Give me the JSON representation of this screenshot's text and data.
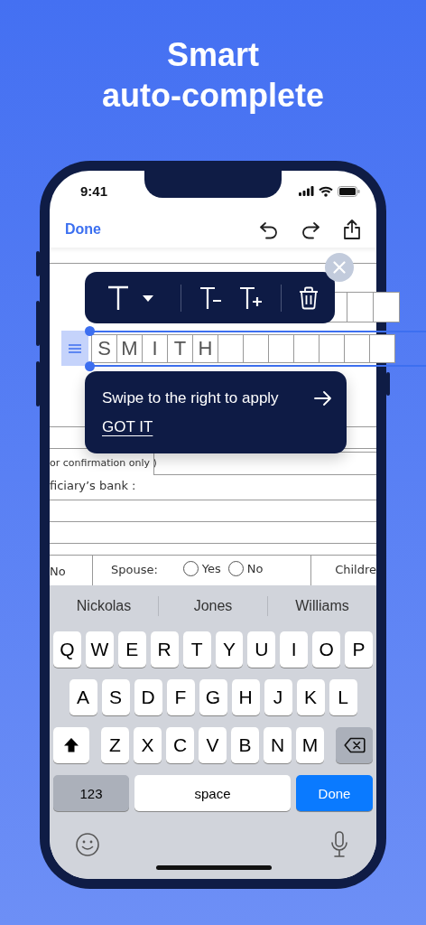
{
  "headline": [
    "Smart",
    "auto-complete"
  ],
  "status_bar": {
    "time": "9:41"
  },
  "nav": {
    "done": "Done"
  },
  "form": {
    "confirmation_note": "or confirmation only )",
    "bank_label": "ficiary’s bank :",
    "row": {
      "no_label": "No",
      "spouse_label": "Spouse:",
      "options": [
        {
          "label": "Yes",
          "selected": false
        },
        {
          "label": "No",
          "selected": false
        }
      ],
      "children_label": "Childre"
    }
  },
  "field": {
    "letters": [
      "S",
      "M",
      "I",
      "T",
      "H"
    ]
  },
  "tip": {
    "text": "Swipe to the right to apply",
    "action": "GOT IT"
  },
  "keyboard": {
    "suggestions": [
      "Nickolas",
      "Jones",
      "Williams"
    ],
    "rows": [
      [
        "Q",
        "W",
        "E",
        "R",
        "T",
        "Y",
        "U",
        "I",
        "O",
        "P"
      ],
      [
        "A",
        "S",
        "D",
        "F",
        "G",
        "H",
        "J",
        "K",
        "L"
      ],
      [
        "Z",
        "X",
        "C",
        "V",
        "B",
        "N",
        "M"
      ]
    ],
    "numbers_key": "123",
    "space_key": "space",
    "return_key": "Done"
  }
}
